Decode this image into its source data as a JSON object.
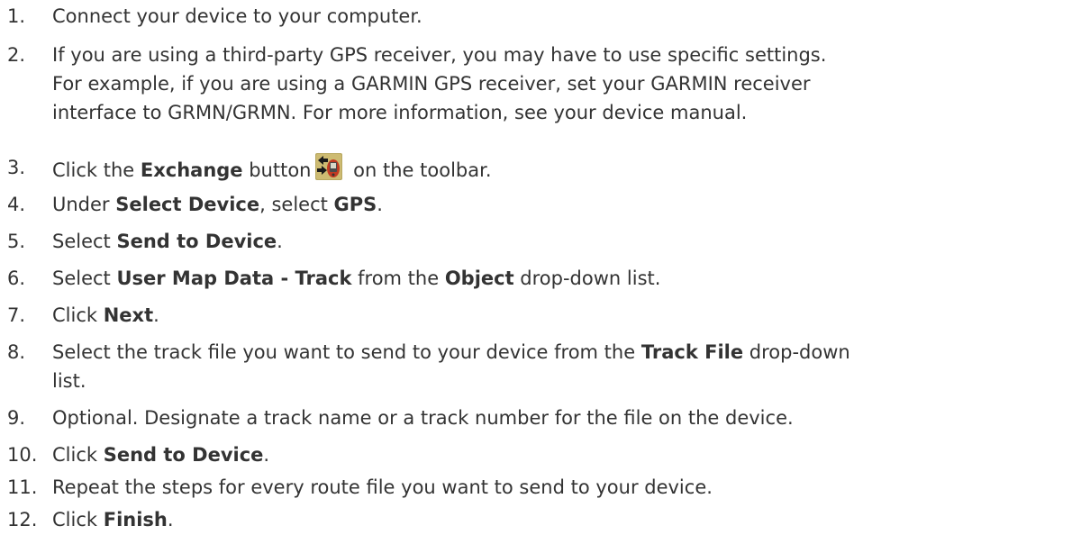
{
  "steps": [
    {
      "num": "1.",
      "parts": [
        "Connect your device to your computer."
      ]
    },
    {
      "num": "2.",
      "lines": [
        "If you are using a third-party GPS receiver, you may have to use specific settings.",
        "For example, if you are using a GARMIN GPS receiver, set your GARMIN receiver",
        "interface to GRMN/GRMN. For more information, see your device manual."
      ]
    },
    {
      "num": "3.",
      "a": "Click the ",
      "b1": "Exchange",
      "c": " button",
      "d": " on the toolbar."
    },
    {
      "num": "4.",
      "a": "Under ",
      "b1": "Select Device",
      "c": ", select ",
      "b2": "GPS",
      "d": "."
    },
    {
      "num": "5.",
      "a": "Select ",
      "b1": "Send to Device",
      "c": "."
    },
    {
      "num": "6.",
      "a": "Select ",
      "b1": "User Map Data - Track",
      "c": " from the ",
      "b2": "Object",
      "d": " drop-down list."
    },
    {
      "num": "7.",
      "a": "Click ",
      "b1": "Next",
      "c": "."
    },
    {
      "num": "8.",
      "a": "Select the track file you want to send to your device from the ",
      "b1": "Track File",
      "c": " drop-down",
      "line2": "list."
    },
    {
      "num": "9.",
      "a": "Optional. Designate a track name or a track number for the file on the device."
    },
    {
      "num": "10.",
      "a": "Click ",
      "b1": "Send to Device",
      "c": "."
    },
    {
      "num": "11.",
      "a": "Repeat the steps for every route file you want to send to your device."
    },
    {
      "num": "12.",
      "a": "Click ",
      "b1": "Finish",
      "c": "."
    }
  ],
  "exchange_icon": {
    "name": "exchange-icon",
    "colors": {
      "body": "#c0392b",
      "arrow": "#1a1a1a",
      "bg": "#b5a35a"
    }
  }
}
